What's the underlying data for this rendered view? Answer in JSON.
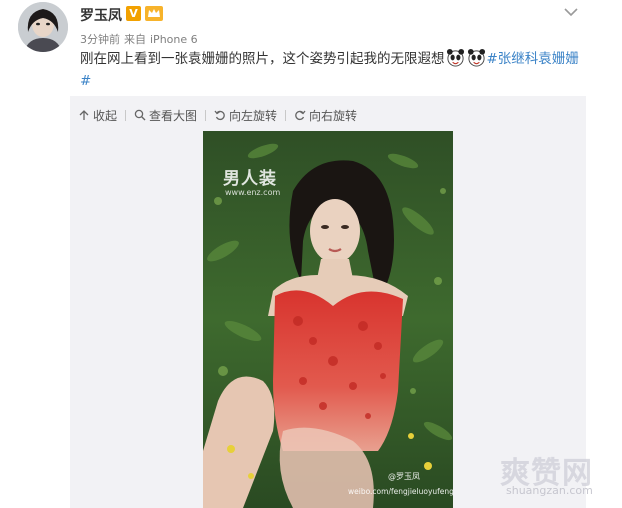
{
  "post": {
    "username": "罗玉凤",
    "verified_badge": "V",
    "time": "3分钟前",
    "source_prefix": "来自",
    "source_device": "iPhone 6",
    "text": "刚在网上看到一张袁姗姗的照片，这个姿势引起我的无限遐想",
    "topic": "#张继科袁姗姗#",
    "link_color": "#3b83c7"
  },
  "toolbar": {
    "collapse_label": "收起",
    "view_large_label": "查看大图",
    "rotate_left_label": "向左旋转",
    "rotate_right_label": "向右旋转"
  },
  "photo": {
    "logo_text": "男人装",
    "logo_sub": "www.enz.com",
    "handle": "@罗玉凤",
    "url": "weibo.com/fengjieluoyufeng"
  },
  "site_watermark": {
    "name": "爽赞网",
    "domain": "shuangzan.com"
  },
  "icons": {
    "verified": "verified-v-icon",
    "member": "member-crown-icon",
    "more": "chevron-down-icon",
    "collapse": "arrow-up-icon",
    "search": "magnifier-icon",
    "rotate_left": "rotate-left-icon",
    "rotate_right": "rotate-right-icon",
    "emoji": "panda-face-emoji"
  }
}
